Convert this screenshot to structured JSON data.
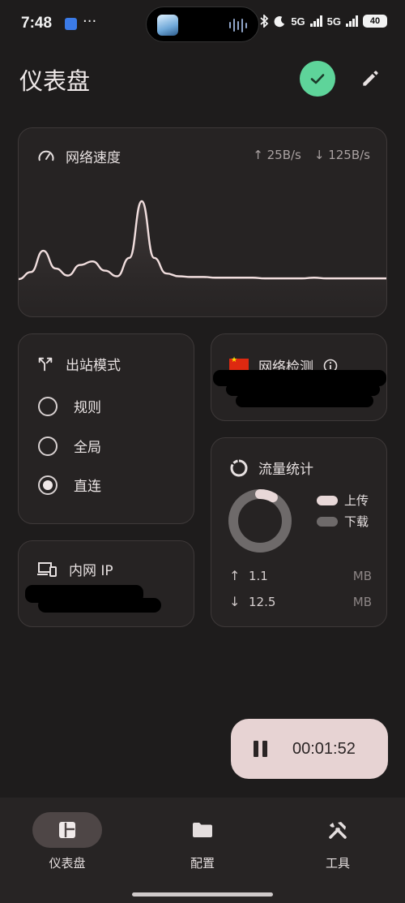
{
  "status_bar": {
    "time": "7:48",
    "more": "···",
    "network_1": "5G",
    "network_2": "5G",
    "battery": "40"
  },
  "header": {
    "title": "仪表盘"
  },
  "speed_card": {
    "title": "网络速度",
    "upload": "↑ 25B/s",
    "download": "↓ 125B/s"
  },
  "chart_data": {
    "type": "area",
    "title": "网络速度",
    "x": [
      0,
      1,
      2,
      3,
      4,
      5,
      6,
      7,
      8,
      9,
      10,
      11,
      12,
      13,
      14,
      15,
      16,
      17,
      18,
      19,
      20,
      21,
      22,
      23,
      24,
      25,
      26,
      27,
      28,
      29,
      30
    ],
    "series": [
      {
        "values": [
          0,
          10,
          40,
          15,
          5,
          20,
          25,
          12,
          4,
          30,
          110,
          30,
          8,
          4,
          3,
          3,
          2,
          2,
          2,
          2,
          1,
          1,
          1,
          1,
          2,
          1,
          1,
          1,
          1,
          1,
          1
        ]
      }
    ]
  },
  "outbound_card": {
    "title": "出站模式",
    "options": [
      {
        "label": "规则",
        "selected": false
      },
      {
        "label": "全局",
        "selected": false
      },
      {
        "label": "直连",
        "selected": true
      }
    ]
  },
  "lan_ip_card": {
    "title": "内网 IP"
  },
  "net_check_card": {
    "title": "网络检测"
  },
  "traffic_card": {
    "title": "流量统计",
    "legend_upload": "上传",
    "legend_download": "下载",
    "upload_value": "1.1",
    "upload_unit": "MB",
    "download_value": "12.5",
    "download_unit": "MB",
    "upload_fraction": 0.08,
    "colors": {
      "upload": "#e8d8d8",
      "download": "#6e6a6a"
    }
  },
  "timer": {
    "elapsed": "00:01:52"
  },
  "nav": {
    "items": [
      {
        "label": "仪表盘",
        "active": true
      },
      {
        "label": "配置",
        "active": false
      },
      {
        "label": "工具",
        "active": false
      }
    ]
  }
}
